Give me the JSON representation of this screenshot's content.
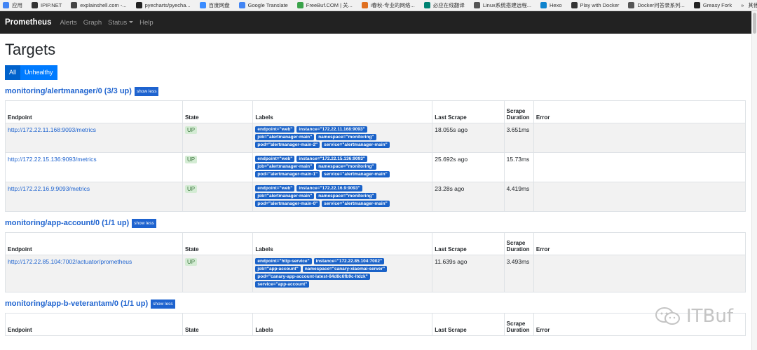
{
  "bookmarks": [
    {
      "label": "应用",
      "color": "#4285f4",
      "icon": "apps-icon"
    },
    {
      "label": "IPIP.NET",
      "color": "#333333",
      "icon": "ipip-icon"
    },
    {
      "label": "explainshell.com -...",
      "color": "#444444",
      "icon": "explainshell-icon"
    },
    {
      "label": "pyecharts/pyecha...",
      "color": "#222222",
      "icon": "github-icon"
    },
    {
      "label": "百度网盘",
      "color": "#3b8cff",
      "icon": "baidu-icon"
    },
    {
      "label": "Google Translate",
      "color": "#4285f4",
      "icon": "translate-icon"
    },
    {
      "label": "FreeBuf.COM | 关...",
      "color": "#3aa34a",
      "icon": "freebuf-icon"
    },
    {
      "label": "i春秋-专业的网络...",
      "color": "#e07020",
      "icon": "ichunqiu-icon"
    },
    {
      "label": "必应在线翻译",
      "color": "#008373",
      "icon": "bing-icon"
    },
    {
      "label": "Linux系统搭建远程...",
      "color": "#555555",
      "icon": "linux-icon"
    },
    {
      "label": "Hexo",
      "color": "#0e83cd",
      "icon": "hexo-icon"
    },
    {
      "label": "Play with Docker",
      "color": "#333333",
      "icon": "docker-icon"
    },
    {
      "label": "Docker问答录系列...",
      "color": "#555555",
      "icon": "doc-icon"
    },
    {
      "label": "Greasy Fork",
      "color": "#222222",
      "icon": "greasyfork-icon"
    }
  ],
  "bookmarks_more": "»",
  "bookmarks_other": "其他书签",
  "navbar": {
    "brand": "Prometheus",
    "links": [
      "Alerts",
      "Graph",
      "Status",
      "Help"
    ]
  },
  "page_title": "Targets",
  "filters": [
    "All",
    "Unhealthy"
  ],
  "show_less": "show less",
  "columns": [
    "Endpoint",
    "State",
    "Labels",
    "Last Scrape",
    "Scrape Duration",
    "Error"
  ],
  "sections": [
    {
      "title": "monitoring/alertmanager/0 (3/3 up)",
      "rows": [
        {
          "endpoint": "http://172.22.11.168:9093/metrics",
          "state": "UP",
          "labels": [
            "endpoint=\"web\"",
            "instance=\"172.22.11.168:9093\"",
            "job=\"alertmanager-main\"",
            "namespace=\"monitoring\"",
            "pod=\"alertmanager-main-2\"",
            "service=\"alertmanager-main\""
          ],
          "last_scrape": "18.055s ago",
          "duration": "3.651ms",
          "error": ""
        },
        {
          "endpoint": "http://172.22.15.136:9093/metrics",
          "state": "UP",
          "labels": [
            "endpoint=\"web\"",
            "instance=\"172.22.15.136:9093\"",
            "job=\"alertmanager-main\"",
            "namespace=\"monitoring\"",
            "pod=\"alertmanager-main-1\"",
            "service=\"alertmanager-main\""
          ],
          "last_scrape": "25.692s ago",
          "duration": "15.73ms",
          "error": ""
        },
        {
          "endpoint": "http://172.22.16.9:9093/metrics",
          "state": "UP",
          "labels": [
            "endpoint=\"web\"",
            "instance=\"172.22.16.9:9093\"",
            "job=\"alertmanager-main\"",
            "namespace=\"monitoring\"",
            "pod=\"alertmanager-main-0\"",
            "service=\"alertmanager-main\""
          ],
          "last_scrape": "23.28s ago",
          "duration": "4.419ms",
          "error": ""
        }
      ]
    },
    {
      "title": "monitoring/app-account/0 (1/1 up)",
      "rows": [
        {
          "endpoint": "http://172.22.85.104:7002/actuator/prometheus",
          "state": "UP",
          "labels": [
            "endpoint=\"http-service\"",
            "instance=\"172.22.85.104:7002\"",
            "job=\"app-account\"",
            "namespace=\"canary-xiaomai-server\"",
            "pod=\"canary-app-account-latest-84d8c6fb9c-ltdzk\"",
            "service=\"app-account\""
          ],
          "last_scrape": "11.639s ago",
          "duration": "3.493ms",
          "error": ""
        }
      ]
    },
    {
      "title": "monitoring/app-b-veterantam/0 (1/1 up)",
      "rows": []
    }
  ],
  "watermark": "ITBuf"
}
